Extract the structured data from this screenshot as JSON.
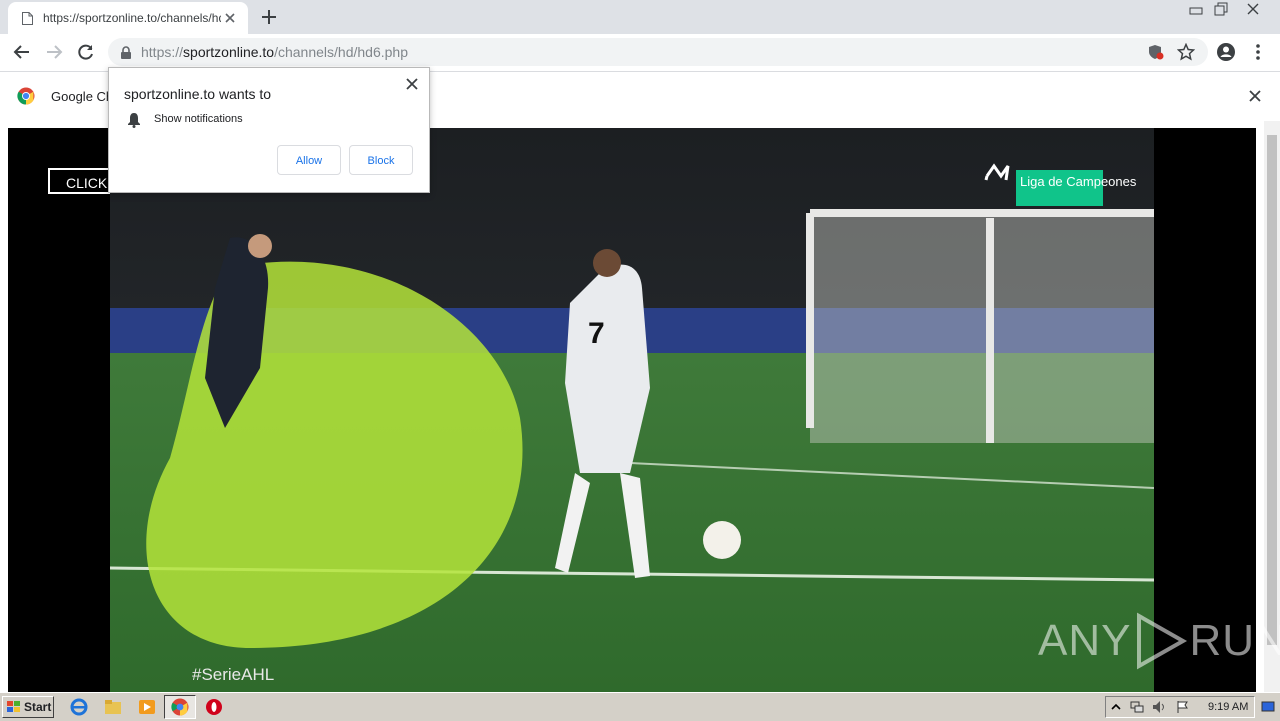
{
  "browser": {
    "tab_title": "https://sportzonline.to/channels/hd/",
    "url_scheme": "https://",
    "url_host": "sportzonline.to",
    "url_path": "/channels/hd/hd6.php"
  },
  "infobar": {
    "text": "Google Ch"
  },
  "popup": {
    "title": "sportzonline.to wants to",
    "permission": "Show notifications",
    "allow_label": "Allow",
    "block_label": "Block"
  },
  "page": {
    "click_label": "CLICK"
  },
  "video": {
    "broadcaster_label": "Liga de Campeones",
    "hashtag": "#SerieAHL",
    "player_number": "7"
  },
  "watermark": {
    "left": "ANY",
    "right": "RUN"
  },
  "taskbar": {
    "start_label": "Start",
    "clock": "9:19 AM"
  }
}
